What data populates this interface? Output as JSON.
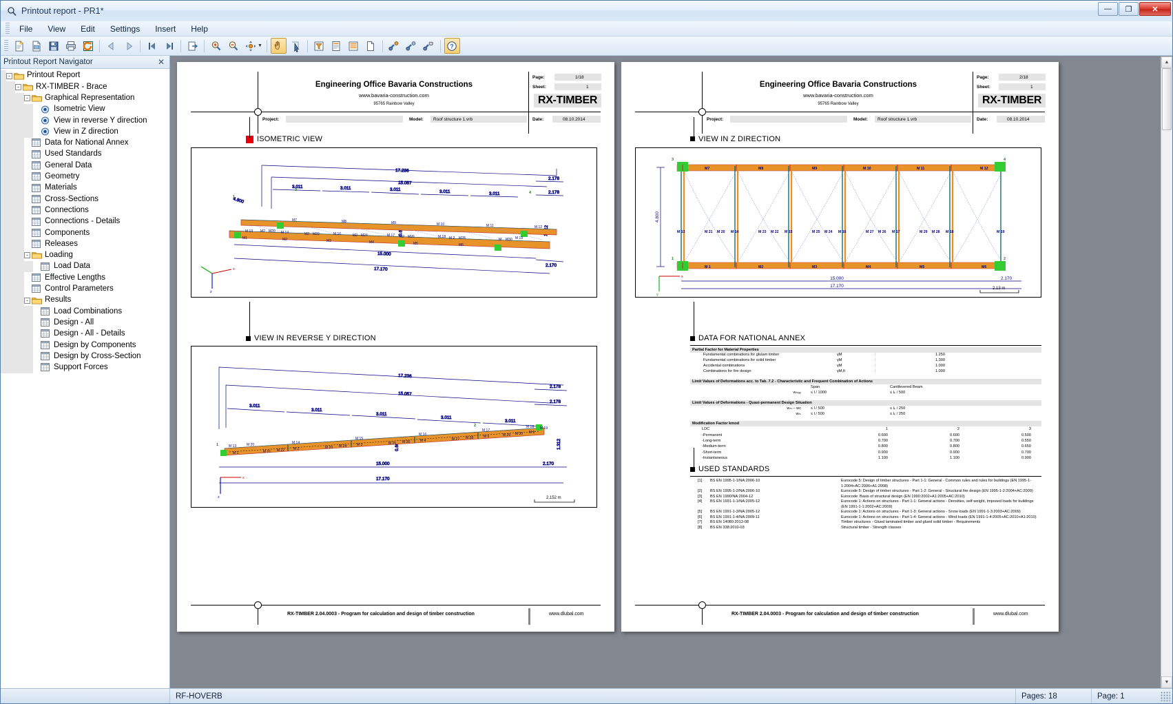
{
  "window": {
    "title": "Printout report - PR1*",
    "icon": "magnifier-document-icon",
    "minimize_label": "—",
    "maximize_label": "❐",
    "close_label": "✕"
  },
  "menu": {
    "items": [
      "File",
      "View",
      "Edit",
      "Settings",
      "Insert",
      "Help"
    ]
  },
  "toolbar": {
    "buttons": [
      {
        "name": "new-report-icon",
        "title": "New"
      },
      {
        "name": "open-report-icon",
        "title": "Open"
      },
      {
        "name": "save-icon",
        "title": "Save"
      },
      {
        "name": "print-icon",
        "title": "Print"
      },
      {
        "name": "refresh-icon",
        "title": "Refresh"
      },
      {
        "name": "previous-page-icon",
        "title": "Previous page"
      },
      {
        "name": "next-page-icon",
        "title": "Next page"
      },
      {
        "name": "first-page-icon",
        "title": "First page"
      },
      {
        "name": "last-page-icon",
        "title": "Last page"
      },
      {
        "name": "export-icon",
        "title": "Export"
      },
      {
        "name": "zoom-in-icon",
        "title": "Zoom in"
      },
      {
        "name": "zoom-out-icon",
        "title": "Zoom out"
      },
      {
        "name": "pan-fit-icon",
        "title": "Fit view"
      },
      {
        "name": "hand-tool-icon",
        "title": "Hand tool"
      },
      {
        "name": "select-tool-icon",
        "title": "Selection tool"
      },
      {
        "name": "filter-icon",
        "title": "Filter"
      },
      {
        "name": "page-properties-icon",
        "title": "Page properties"
      },
      {
        "name": "page-layout-icon",
        "title": "Page layout"
      },
      {
        "name": "blank-page-icon",
        "title": "Blank page"
      },
      {
        "name": "link-add-icon",
        "title": "Add link"
      },
      {
        "name": "link-edit-icon",
        "title": "Edit link"
      },
      {
        "name": "link-lock-icon",
        "title": "Lock link"
      },
      {
        "name": "help-icon",
        "title": "Help"
      }
    ]
  },
  "navigator": {
    "header": "Printout Report Navigator",
    "close_label": "✕",
    "tree": [
      {
        "depth": 0,
        "label": "Printout Report",
        "icon": "folder-icon",
        "expander": "-"
      },
      {
        "depth": 1,
        "label": "RX-TIMBER - Brace",
        "icon": "folder-icon",
        "expander": "-"
      },
      {
        "depth": 2,
        "label": "Graphical Representation",
        "icon": "folder-icon",
        "expander": "-"
      },
      {
        "depth": 3,
        "label": "Isometric View",
        "icon": "view-icon",
        "expander": ""
      },
      {
        "depth": 3,
        "label": "View in reverse Y direction",
        "icon": "view-icon",
        "expander": ""
      },
      {
        "depth": 3,
        "label": "View in Z direction",
        "icon": "view-icon",
        "expander": ""
      },
      {
        "depth": 2,
        "label": "Data for National Annex",
        "icon": "table-icon",
        "expander": ""
      },
      {
        "depth": 2,
        "label": "Used Standards",
        "icon": "table-icon",
        "expander": ""
      },
      {
        "depth": 2,
        "label": "General Data",
        "icon": "table-icon",
        "expander": ""
      },
      {
        "depth": 2,
        "label": "Geometry",
        "icon": "table-icon",
        "expander": ""
      },
      {
        "depth": 2,
        "label": "Materials",
        "icon": "table-icon",
        "expander": ""
      },
      {
        "depth": 2,
        "label": "Cross-Sections",
        "icon": "table-icon",
        "expander": ""
      },
      {
        "depth": 2,
        "label": "Connections",
        "icon": "table-icon",
        "expander": ""
      },
      {
        "depth": 2,
        "label": "Connections - Details",
        "icon": "table-icon",
        "expander": ""
      },
      {
        "depth": 2,
        "label": "Components",
        "icon": "table-icon",
        "expander": ""
      },
      {
        "depth": 2,
        "label": "Releases",
        "icon": "table-icon",
        "expander": ""
      },
      {
        "depth": 2,
        "label": "Loading",
        "icon": "folder-icon",
        "expander": "-"
      },
      {
        "depth": 3,
        "label": "Load Data",
        "icon": "table-icon",
        "expander": ""
      },
      {
        "depth": 2,
        "label": "Effective Lengths",
        "icon": "table-icon",
        "expander": ""
      },
      {
        "depth": 2,
        "label": "Control Parameters",
        "icon": "table-icon",
        "expander": ""
      },
      {
        "depth": 2,
        "label": "Results",
        "icon": "folder-icon",
        "expander": "-"
      },
      {
        "depth": 3,
        "label": "Load Combinations",
        "icon": "table-icon",
        "expander": ""
      },
      {
        "depth": 3,
        "label": "Design - All",
        "icon": "table-icon",
        "expander": ""
      },
      {
        "depth": 3,
        "label": "Design - All - Details",
        "icon": "table-icon",
        "expander": ""
      },
      {
        "depth": 3,
        "label": "Design by Components",
        "icon": "table-icon",
        "expander": ""
      },
      {
        "depth": 3,
        "label": "Design by Cross-Section",
        "icon": "table-icon",
        "expander": ""
      },
      {
        "depth": 3,
        "label": "Support Forces",
        "icon": "table-icon",
        "expander": ""
      }
    ]
  },
  "report": {
    "company_name": "Engineering Office Bavaria Constructions",
    "company_url": "www.bavaria-construction.com",
    "company_address": "95765 Rainbow Valley",
    "brand": "RX-TIMBER",
    "label_page": "Page:",
    "label_sheet": "Sheet:",
    "label_project": "Project:",
    "label_model": "Model:",
    "label_date": "Date:",
    "project_value": "",
    "model_value": "Roof structure 1.vrb",
    "date_value": "08.10.2014",
    "footer_text": "RX-TIMBER 2.04.0003 - Program for calculation and design of timber construction",
    "footer_url": "www.dlubal.com",
    "page1": {
      "page_no": "1/18",
      "sheet_no": "1"
    },
    "page2": {
      "page_no": "2/18",
      "sheet_no": "1"
    }
  },
  "sections": {
    "isometric_view": "ISOMETRIC VIEW",
    "reverse_y_view": "VIEW IN REVERSE Y DIRECTION",
    "z_view": "VIEW IN Z DIRECTION",
    "national_annex": "DATA FOR NATIONAL ANNEX",
    "used_standards": "USED STANDARDS"
  },
  "drawings": {
    "isometric": {
      "dims": [
        "17.236",
        "15.057",
        "3.011",
        "3.011",
        "3.011",
        "3.011",
        "3.011",
        "2.178",
        "2.178",
        "15.000",
        "17.170",
        "2.170",
        "4.800",
        "1.312",
        "0.600"
      ],
      "members": [
        "M7",
        "M8",
        "M9",
        "M 10",
        "M 11",
        "M 12",
        "M 13",
        "M 14",
        "M 16",
        "M 17",
        "M 18",
        "M 19",
        "M1",
        "M2",
        "M3",
        "M4",
        "M5",
        "M6",
        "M20",
        "M22",
        "M24",
        "M26",
        "M28",
        "M30"
      ],
      "node_labels": [
        "1",
        "2",
        "3",
        "4"
      ],
      "axis_labels": [
        "x",
        "y",
        "z"
      ]
    },
    "reverse_y": {
      "dims": [
        "17.236",
        "15.057",
        "3.011",
        "3.011",
        "3.011",
        "3.011",
        "3.011",
        "2.178",
        "2.178",
        "15.000",
        "17.170",
        "2.170",
        "1.312",
        "0.600"
      ],
      "members": [
        "M 13",
        "M 20",
        "M 1",
        "M 21",
        "M 22",
        "M 2",
        "M 14",
        "M 23",
        "M 24",
        "M 3",
        "M 15",
        "M 25",
        "M 26",
        "M 4",
        "M 16",
        "M 27",
        "M 28",
        "M 5",
        "M 17",
        "M 29",
        "M 30",
        "M 6",
        "M 18",
        "M 19"
      ],
      "scale_bar": "2.152 m",
      "axis_labels": [
        "x",
        "z"
      ]
    },
    "z_direction": {
      "dims": [
        "4.800",
        "15.000",
        "17.170",
        "2.170"
      ],
      "members_top": [
        "M7",
        "M8",
        "M9",
        "M 10",
        "M 11",
        "M 12"
      ],
      "members_bottom": [
        "M1",
        "M2",
        "M3",
        "M4",
        "M5",
        "M6"
      ],
      "columns": [
        "M 13",
        "M 14",
        "M 15",
        "M 16",
        "M 17",
        "M 18",
        "M 19"
      ],
      "diagonals": [
        "M 21",
        "M 20",
        "M 23",
        "M 22",
        "M 25",
        "M 24",
        "M 27",
        "M 26",
        "M 29",
        "M 28"
      ],
      "node_labels": [
        "1",
        "2",
        "3",
        "4"
      ],
      "scale_bar": "2.13 m",
      "axis_labels": [
        "x",
        "y"
      ]
    }
  },
  "national_annex": {
    "group1_title": "Partial Factor for Material Properties",
    "group1_rows": [
      {
        "name": "Fundamental combinations  for glulam timber",
        "sym": "γM",
        "colon": ":",
        "value": "1.250"
      },
      {
        "name": "Fundamental combinations  for solid timber",
        "sym": "γM",
        "colon": ":",
        "value": "1.300"
      },
      {
        "name": "Accidental combinations",
        "sym": "γM",
        "colon": ":",
        "value": "1.000"
      },
      {
        "name": "Combinations for fire design",
        "sym": "γM,fi",
        "colon": ":",
        "value": "1.000"
      }
    ],
    "group2_title": "Limit Values of Deformations acc. to Tab. 7.2 - Characteristic and Frequent Combination of Actions",
    "group2_headers": {
      "span": "Span",
      "cantilever": "Cantilevered Beam"
    },
    "group2_rows": [
      {
        "sym": "wₘₐₓ",
        "span": "≤ l / 1000",
        "cantilever": "≤ lₖ / 500"
      }
    ],
    "group3_title": "Limit Values of Deformations - Quasi-permanent Design Situation",
    "group3_rows": [
      {
        "sym": "wₘ – wᴄ",
        "span": "≤ l / 500",
        "cantilever": "≤ lₖ / 250"
      },
      {
        "sym": "wₘ",
        "span": "≤ l / 500",
        "cantilever": "≤ lₖ / 250"
      }
    ],
    "group4_title": "Modification Factor kmod",
    "group4_header": {
      "label": "LDC",
      "c1": "1",
      "c2": "2",
      "c3": "3"
    },
    "group4_rows": [
      {
        "name": "-Permanent",
        "c1": "0.600",
        "c2": "0.600",
        "c3": "0.500"
      },
      {
        "name": "-Long-term",
        "c1": "0.700",
        "c2": "0.700",
        "c3": "0.550"
      },
      {
        "name": "-Medium-term",
        "c1": "0.800",
        "c2": "0.800",
        "c3": "0.650"
      },
      {
        "name": "-Short-term",
        "c1": "0.900",
        "c2": "0.900",
        "c3": "0.700"
      },
      {
        "name": "-Instantaneous",
        "c1": "1.100",
        "c2": "1.100",
        "c3": "0.900"
      }
    ]
  },
  "used_standards": {
    "rows": [
      {
        "no": "[1]",
        "code": "BS EN 1995-1-1/NA:2006-10",
        "desc": "Eurocode 5: Design of timber structures - Part 1-1: General - Common rules and rules for buildings (EN 1995-1-1:2004+AC:2006+A1:2008)"
      },
      {
        "no": "[2]",
        "code": "BS EN 1995-1-2/NA:2006-10",
        "desc": "Eurocode 5: Design of timber structures - Part 1-2: General - Structural fire design (EN 1995-1-2:2004+AC:2009)"
      },
      {
        "no": "[3]",
        "code": "BS EN 1990/NA:2004-12",
        "desc": "Eurocode: Basis of structural design (EN 1990:2002+A1:2005+AC:2010)"
      },
      {
        "no": "[4]",
        "code": "BS EN 1991-1-1/NA:2005-12",
        "desc": "Eurocode 1: Actions on structures - Part 1-1: General actions - Densities, self-weight, imposed loads for buildings (EN 1991-1-1:2002+AC:2009)"
      },
      {
        "no": "[5]",
        "code": "BS EN 1991-1-3/NA:2005-12",
        "desc": "Eurocode 1: Actions on structures - Part 1-3: General actions - Snow loads (EN 1991-1-3:2003+AC:2009)"
      },
      {
        "no": "[6]",
        "code": "BS EN 1991-1-4/NA:2009-11",
        "desc": "Eurocode 1: Actions on structures - Part 1-4: General actions - Wind loads (EN 1991-1-4:2005+AC:2010+A1:2010)"
      },
      {
        "no": "[7]",
        "code": "BS EN 14080:2013-08",
        "desc": "Timber structures - Glued laminated timber and glued solid timber - Requirements"
      },
      {
        "no": "[8]",
        "code": "BS EN 338:2010-03",
        "desc": "Structural timber - Strength classes"
      }
    ]
  },
  "statusbar": {
    "message": "RF-HOVERB",
    "pages": "Pages: 18",
    "page": "Page: 1"
  },
  "colors": {
    "accent_red": "#e8000d",
    "timber_orange": "#e8922a",
    "line_blue": "#000080",
    "support_green": "#33cc33",
    "brand_bg": "#e2e2e2"
  }
}
